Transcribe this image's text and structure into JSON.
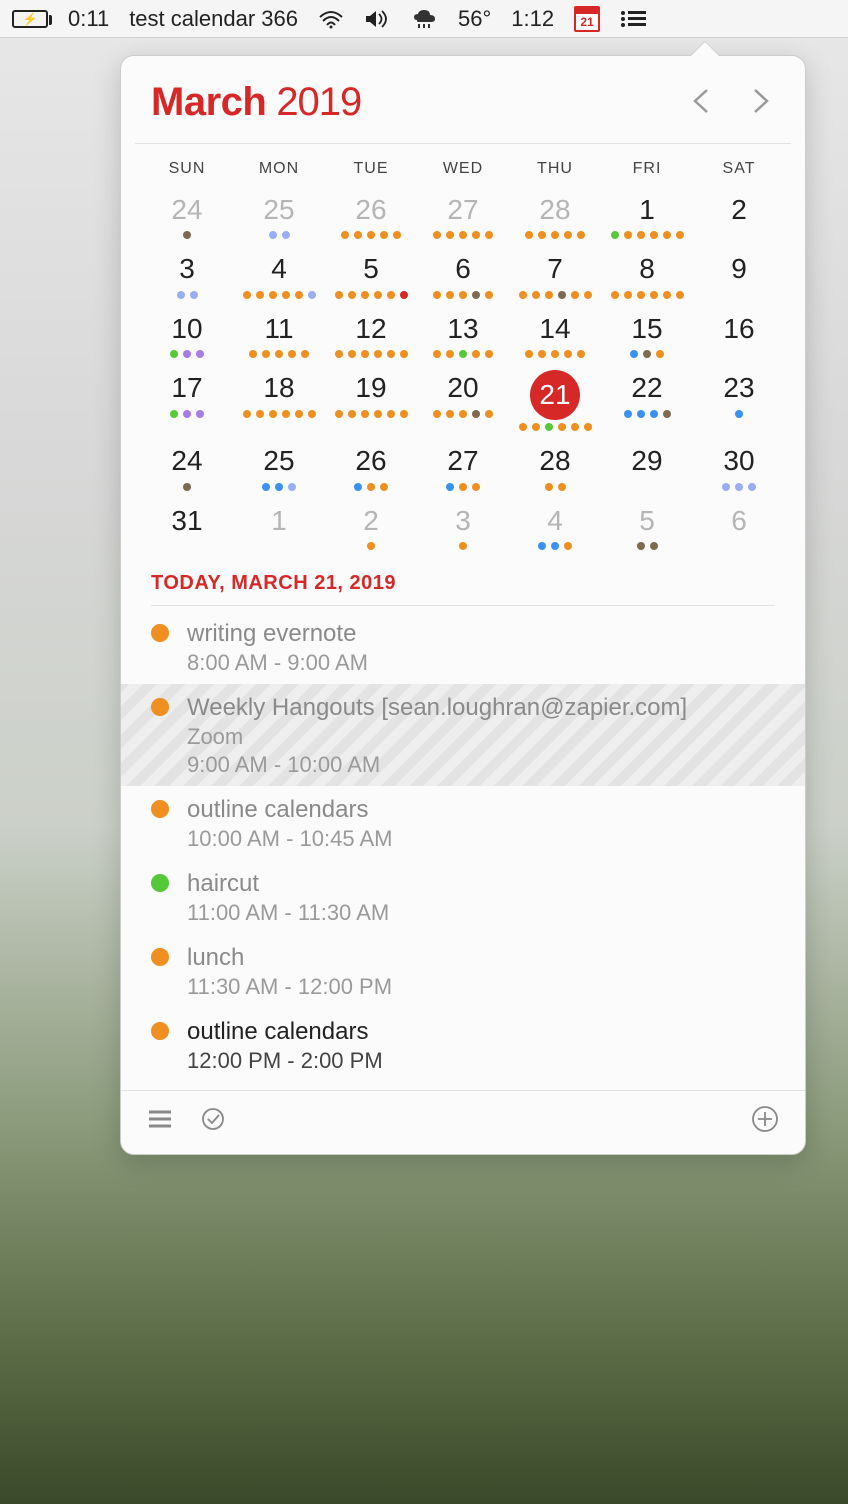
{
  "menubar": {
    "charging_text": "⚡",
    "timer": "0:11",
    "app_label": "test calendar 366",
    "temp": "56°",
    "clock": "1:12",
    "cal_date": "21"
  },
  "header": {
    "month": "March",
    "year": "2019"
  },
  "dow": [
    "SUN",
    "MON",
    "TUE",
    "WED",
    "THU",
    "FRI",
    "SAT"
  ],
  "cells": [
    {
      "n": "24",
      "faded": true,
      "dots": [
        "brown"
      ]
    },
    {
      "n": "25",
      "faded": true,
      "dots": [
        "lblue",
        "lblue"
      ]
    },
    {
      "n": "26",
      "faded": true,
      "dots": [
        "orange",
        "orange",
        "orange",
        "orange",
        "orange"
      ]
    },
    {
      "n": "27",
      "faded": true,
      "dots": [
        "orange",
        "orange",
        "orange",
        "orange",
        "orange"
      ]
    },
    {
      "n": "28",
      "faded": true,
      "dots": [
        "orange",
        "orange",
        "orange",
        "orange",
        "orange"
      ]
    },
    {
      "n": "1",
      "dots": [
        "green",
        "orange",
        "orange",
        "orange",
        "orange",
        "orange"
      ]
    },
    {
      "n": "2",
      "dots": []
    },
    {
      "n": "3",
      "dots": [
        "lblue",
        "lblue"
      ]
    },
    {
      "n": "4",
      "dots": [
        "orange",
        "orange",
        "orange",
        "orange",
        "orange",
        "lblue"
      ]
    },
    {
      "n": "5",
      "dots": [
        "orange",
        "orange",
        "orange",
        "orange",
        "orange",
        "red"
      ]
    },
    {
      "n": "6",
      "dots": [
        "orange",
        "orange",
        "orange",
        "brown",
        "orange"
      ]
    },
    {
      "n": "7",
      "dots": [
        "orange",
        "orange",
        "orange",
        "brown",
        "orange",
        "orange"
      ]
    },
    {
      "n": "8",
      "dots": [
        "orange",
        "orange",
        "orange",
        "orange",
        "orange",
        "orange"
      ]
    },
    {
      "n": "9",
      "dots": []
    },
    {
      "n": "10",
      "dots": [
        "green",
        "purple",
        "purple"
      ]
    },
    {
      "n": "11",
      "dots": [
        "orange",
        "orange",
        "orange",
        "orange",
        "orange"
      ]
    },
    {
      "n": "12",
      "dots": [
        "orange",
        "orange",
        "orange",
        "orange",
        "orange",
        "orange"
      ]
    },
    {
      "n": "13",
      "dots": [
        "orange",
        "orange",
        "green",
        "orange",
        "orange"
      ]
    },
    {
      "n": "14",
      "dots": [
        "orange",
        "orange",
        "orange",
        "orange",
        "orange"
      ]
    },
    {
      "n": "15",
      "dots": [
        "blue",
        "brown",
        "orange"
      ]
    },
    {
      "n": "16",
      "dots": []
    },
    {
      "n": "17",
      "dots": [
        "green",
        "purple",
        "purple"
      ]
    },
    {
      "n": "18",
      "dots": [
        "orange",
        "orange",
        "orange",
        "orange",
        "orange",
        "orange"
      ]
    },
    {
      "n": "19",
      "dots": [
        "orange",
        "orange",
        "orange",
        "orange",
        "orange",
        "orange"
      ]
    },
    {
      "n": "20",
      "dots": [
        "orange",
        "orange",
        "orange",
        "brown",
        "orange"
      ]
    },
    {
      "n": "21",
      "today": true,
      "dots": [
        "orange",
        "orange",
        "green",
        "orange",
        "orange",
        "orange"
      ]
    },
    {
      "n": "22",
      "dots": [
        "blue",
        "blue",
        "blue",
        "brown"
      ]
    },
    {
      "n": "23",
      "dots": [
        "blue"
      ]
    },
    {
      "n": "24",
      "dots": [
        "brown"
      ]
    },
    {
      "n": "25",
      "dots": [
        "blue",
        "blue",
        "lblue"
      ]
    },
    {
      "n": "26",
      "dots": [
        "blue",
        "orange",
        "orange"
      ]
    },
    {
      "n": "27",
      "dots": [
        "blue",
        "orange",
        "orange"
      ]
    },
    {
      "n": "28",
      "dots": [
        "orange",
        "orange"
      ]
    },
    {
      "n": "29",
      "dots": []
    },
    {
      "n": "30",
      "dots": [
        "lblue",
        "lblue",
        "lblue"
      ]
    },
    {
      "n": "31",
      "dots": []
    },
    {
      "n": "1",
      "faded": true,
      "dots": []
    },
    {
      "n": "2",
      "faded": true,
      "dots": [
        "orange"
      ]
    },
    {
      "n": "3",
      "faded": true,
      "dots": [
        "orange"
      ]
    },
    {
      "n": "4",
      "faded": true,
      "dots": [
        "blue",
        "blue",
        "orange"
      ]
    },
    {
      "n": "5",
      "faded": true,
      "dots": [
        "brown",
        "brown"
      ]
    },
    {
      "n": "6",
      "faded": true,
      "dots": []
    }
  ],
  "today_label": "TODAY, MARCH 21, 2019",
  "events": [
    {
      "color": "orange",
      "title": "writing evernote",
      "time": "8:00 AM - 9:00 AM"
    },
    {
      "color": "orange",
      "title": "Weekly Hangouts [sean.loughran@zapier.com]",
      "loc": "Zoom",
      "time": "9:00 AM - 10:00 AM",
      "striped": true
    },
    {
      "color": "orange",
      "title": "outline calendars",
      "time": "10:00 AM - 10:45 AM"
    },
    {
      "color": "green",
      "title": "haircut",
      "time": "11:00 AM - 11:30 AM"
    },
    {
      "color": "orange",
      "title": "lunch",
      "time": "11:30 AM - 12:00 PM"
    },
    {
      "color": "orange",
      "title": "outline calendars",
      "time": "12:00 PM - 2:00 PM",
      "current": true
    }
  ]
}
